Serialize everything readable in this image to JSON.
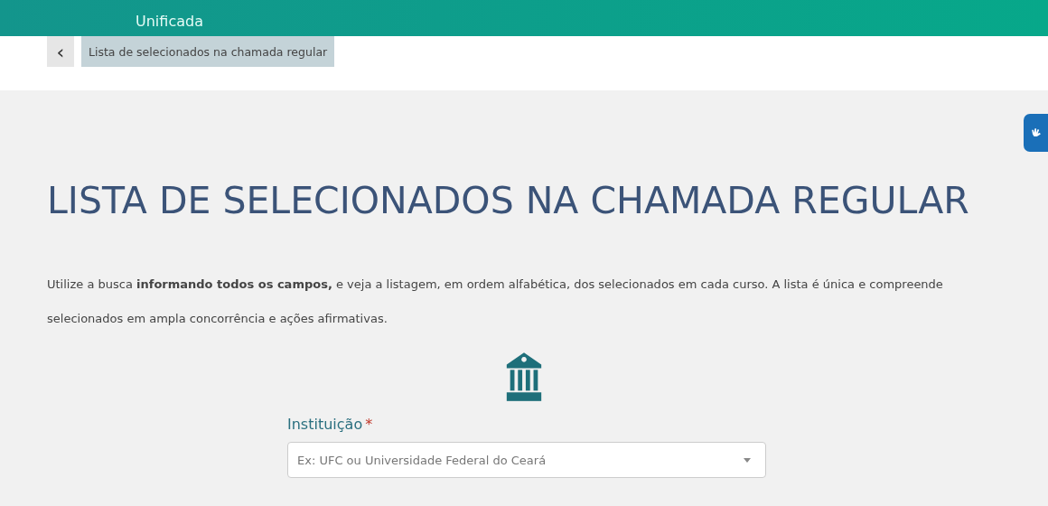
{
  "header": {
    "subtitle": "Unificada"
  },
  "breadcrumb": {
    "back": "‹",
    "current": "Lista de selecionados na chamada regular"
  },
  "title": "LISTA DE SELECIONADOS NA CHAMADA REGULAR",
  "intro": "Utilize a busca **informando todos os campos,** e veja a listagem, em ordem alfabética, dos selecionados em cada curso. A lista é única e compreende selecionados em ampla concorrência e ações afirmativas.",
  "field": {
    "label": "Instituição",
    "required_mark": "*",
    "placeholder": "Ex: UFC ou Universidade Federal do Ceará"
  }
}
